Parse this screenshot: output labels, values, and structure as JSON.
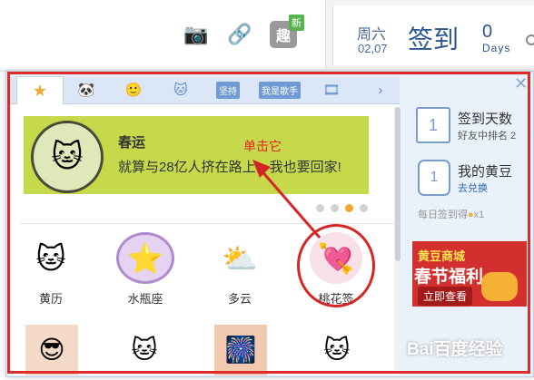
{
  "toolbar": {
    "camera_icon": "camera-icon",
    "attach_icon": "paperclip-icon",
    "qu_label": "趣",
    "new_badge": "新"
  },
  "checkin": {
    "weekday": "周六",
    "date": "02,07",
    "title": "签到",
    "days_count": "0",
    "days_label": "Days"
  },
  "tabs": [
    {
      "name": "hot",
      "label": "HOT",
      "icon": "star-icon",
      "active": true
    },
    {
      "name": "panda",
      "label": "",
      "icon": "panda-icon"
    },
    {
      "name": "face",
      "label": "",
      "icon": "face-icon"
    },
    {
      "name": "cat",
      "label": "",
      "icon": "cat-icon"
    },
    {
      "name": "jianchi",
      "label": "坚持"
    },
    {
      "name": "singer",
      "label": "我是歌手",
      "icon": "seven-icon"
    },
    {
      "name": "film",
      "label": "",
      "icon": "film-icon"
    }
  ],
  "banner": {
    "title": "春运",
    "text": "就算与28亿人挤在路上，我也要回家!"
  },
  "annotation": {
    "text": "单击它"
  },
  "grid": [
    {
      "label": "黄历"
    },
    {
      "label": "水瓶座"
    },
    {
      "label": "多云"
    },
    {
      "label": "桃花签"
    }
  ],
  "sidebar": {
    "checkin_days_label": "签到天数",
    "checkin_icon_text": "1",
    "friend_rank": "好友中排名 2",
    "beans_label": "我的黄豆",
    "beans_icon_text": "1",
    "redeem_link": "去兑换",
    "daily_text": "每日签到得",
    "daily_reward": "x1",
    "ad_line1": "黄豆商城",
    "ad_line2": "春节福利",
    "ad_button": "立即查看",
    "close_label": "✕"
  },
  "watermark": "Bai百度经验",
  "colors": {
    "accent": "#2b5592",
    "annotation_red": "#e02b2b",
    "banner_green": "#c6d94a",
    "popup_bg": "#e9f1fa"
  }
}
